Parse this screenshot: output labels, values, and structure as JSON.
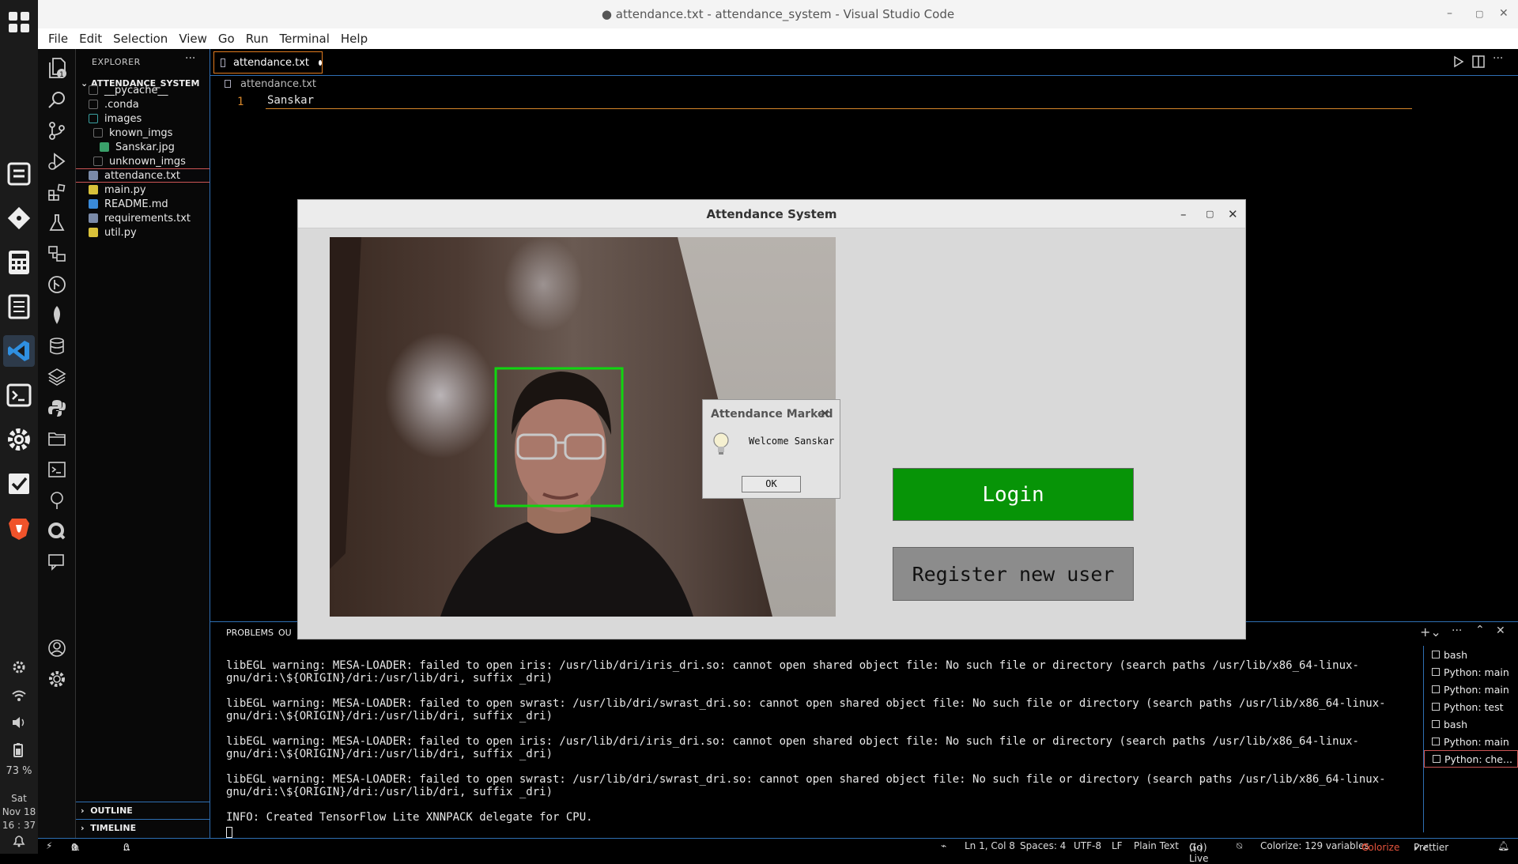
{
  "window_title": "● attendance.txt - attendance_system - Visual Studio Code",
  "menu": [
    "File",
    "Edit",
    "Selection",
    "View",
    "Go",
    "Run",
    "Terminal",
    "Help"
  ],
  "dock": {
    "battery": "73 %",
    "day": "Sat",
    "date": "Nov 18",
    "time": "16 : 37"
  },
  "activity": {
    "explorer_badge": "1"
  },
  "sidebar": {
    "header": "EXPLORER",
    "more": "···",
    "root": "ATTENDANCE_SYSTEM",
    "items": [
      {
        "label": "__pycache__",
        "kind": "folder",
        "color": "#6b6b6b"
      },
      {
        "label": ".conda",
        "kind": "folder",
        "color": "#6b6b6b"
      },
      {
        "label": "images",
        "kind": "folder",
        "color": "#3aa0a0"
      },
      {
        "label": "known_imgs",
        "kind": "folder",
        "color": "#6b6b6b"
      },
      {
        "label": "Sanskar.jpg",
        "kind": "image",
        "color": "#3aa06a"
      },
      {
        "label": "unknown_imgs",
        "kind": "folder",
        "color": "#6b6b6b"
      },
      {
        "label": "attendance.txt",
        "kind": "text",
        "color": "#7a8aa8"
      },
      {
        "label": "main.py",
        "kind": "python",
        "color": "#d9c13a"
      },
      {
        "label": "README.md",
        "kind": "info",
        "color": "#3a8ad9"
      },
      {
        "label": "requirements.txt",
        "kind": "text",
        "color": "#7a8aa8"
      },
      {
        "label": "util.py",
        "kind": "python",
        "color": "#d9c13a"
      }
    ],
    "outline": "OUTLINE",
    "timeline": "TIMELINE"
  },
  "editor": {
    "tab_label": "attendance.txt",
    "breadcrumb": "attendance.txt",
    "line_number": "1",
    "line_text": "Sanskar"
  },
  "panel": {
    "tab_problems": "PROBLEMS",
    "tab_output": "OU",
    "terminal_lines": [
      "libEGL warning: MESA-LOADER: failed to open iris: /usr/lib/dri/iris_dri.so: cannot open shared object file: No such file or directory (search paths /usr/lib/x86_64-linux-gnu/dri:\\${ORIGIN}/dri:/usr/lib/dri, suffix _dri)",
      "libEGL warning: MESA-LOADER: failed to open swrast: /usr/lib/dri/swrast_dri.so: cannot open shared object file: No such file or directory (search paths /usr/lib/x86_64-linux-gnu/dri:\\${ORIGIN}/dri:/usr/lib/dri, suffix _dri)",
      "libEGL warning: MESA-LOADER: failed to open iris: /usr/lib/dri/iris_dri.so: cannot open shared object file: No such file or directory (search paths /usr/lib/x86_64-linux-gnu/dri:\\${ORIGIN}/dri:/usr/lib/dri, suffix _dri)",
      "libEGL warning: MESA-LOADER: failed to open swrast: /usr/lib/dri/swrast_dri.so: cannot open shared object file: No such file or directory (search paths /usr/lib/x86_64-linux-gnu/dri:\\${ORIGIN}/dri:/usr/lib/dri, suffix _dri)",
      "INFO: Created TensorFlow Lite XNNPACK delegate for CPU."
    ],
    "terminals": [
      "bash",
      "Python: main",
      "Python: main",
      "Python: test",
      "bash",
      "Python: main",
      "Python: che..."
    ]
  },
  "status": {
    "errors": "0",
    "warnings": "0",
    "ports": "0",
    "position": "Ln 1, Col 8",
    "spaces": "Spaces: 4",
    "encoding": "UTF-8",
    "eol": "LF",
    "language": "Plain Text",
    "golive": "Go Live",
    "colorize_vars": "Colorize: 129 variables",
    "colorize": "Colorize",
    "prettier": "Prettier"
  },
  "app": {
    "title": "Attendance System",
    "login_label": "Login",
    "register_label": "Register new user",
    "login_color": "#079407"
  },
  "dialog": {
    "title": "Attendance Marked",
    "message": "Welcome Sanskar",
    "ok": "OK"
  }
}
